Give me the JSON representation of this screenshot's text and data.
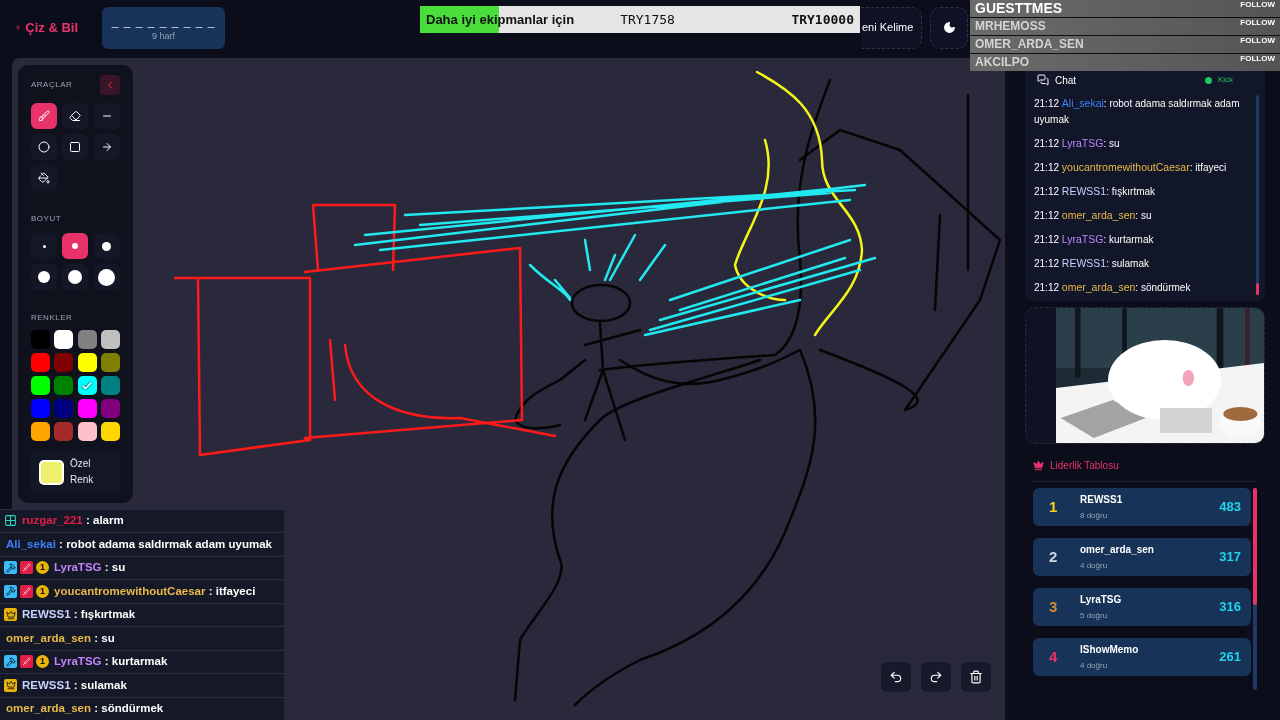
{
  "app": {
    "title": "Çiz & Bil"
  },
  "word_hint": {
    "blanks": "_ _ _ _ _ _ _ _ _",
    "letters": "9 harf"
  },
  "donation_goal": {
    "title": "Daha iyi ekipmanlar için",
    "current": "TRY1758",
    "target": "TRY10000",
    "level": 0.18
  },
  "header_buttons": [
    {
      "kind": "new-word",
      "label": "eni Kelime"
    },
    {
      "kind": "theme"
    }
  ],
  "follower_list": [
    {
      "name": "GUESTTMES",
      "action": "FOLLOW"
    },
    {
      "name": "MRHEMOSS",
      "action": "FOLLOW"
    },
    {
      "name": "OMER_ARDA_SEN",
      "action": "FOLLOW"
    },
    {
      "name": "AKCILPO",
      "action": "FOLLOW"
    }
  ],
  "tools": {
    "heading": "ARAÇLAR",
    "items": [
      {
        "kind": "brush",
        "selected": true
      },
      {
        "kind": "eraser",
        "selected": false
      },
      {
        "kind": "line",
        "selected": false
      },
      {
        "kind": "circle",
        "selected": false
      },
      {
        "kind": "rectangle",
        "selected": false
      },
      {
        "kind": "arrow",
        "selected": false
      },
      {
        "kind": "fill",
        "selected": false
      }
    ],
    "sizes_heading": "BOYUT",
    "sizes": [
      {
        "selected": false
      },
      {
        "selected": true
      },
      {
        "selected": false
      },
      {
        "selected": false
      },
      {
        "selected": false
      },
      {
        "selected": false
      }
    ],
    "colors_heading": "RENKLER",
    "colors": [
      {
        "color": "#000000",
        "selected": false
      },
      {
        "color": "#ffffff",
        "selected": false
      },
      {
        "color": "#808080",
        "selected": false
      },
      {
        "color": "#c0c0c0",
        "selected": false
      },
      {
        "color": "#ff0000",
        "selected": false
      },
      {
        "color": "#800000",
        "selected": false
      },
      {
        "color": "#ffff00",
        "selected": false
      },
      {
        "color": "#808000",
        "selected": false
      },
      {
        "color": "#00ff00",
        "selected": false
      },
      {
        "color": "#008000",
        "selected": false
      },
      {
        "color": "#00ffff",
        "selected": true
      },
      {
        "color": "#008080",
        "selected": false
      },
      {
        "color": "#0000ff",
        "selected": false
      },
      {
        "color": "#000080",
        "selected": false
      },
      {
        "color": "#ff00ff",
        "selected": false
      },
      {
        "color": "#800080",
        "selected": false
      },
      {
        "color": "#ffa500",
        "selected": false
      },
      {
        "color": "#a52a2a",
        "selected": false
      },
      {
        "color": "#ffc0cb",
        "selected": false
      },
      {
        "color": "#ffd700",
        "selected": false
      }
    ],
    "custom_color": {
      "label": "Özel Renk",
      "color": "#eef06a"
    }
  },
  "canvas_controls": [
    {
      "kind": "undo"
    },
    {
      "kind": "redo"
    },
    {
      "kind": "clear"
    }
  ],
  "chat": {
    "title": "Chat",
    "platform": "Kick",
    "separator": ":",
    "messages": [
      {
        "time": "21:12",
        "user": "Ali_sekai",
        "color": "#3b82f6",
        "text": "robot adama saldırmak adam uyumak"
      },
      {
        "time": "21:12",
        "user": "LyraTSG",
        "color": "#c084fc",
        "text": "su"
      },
      {
        "time": "21:12",
        "user": "youcantromewithoutCaesar",
        "color": "#e9b949",
        "text": "itfayeci"
      },
      {
        "time": "21:12",
        "user": "REWSS1",
        "color": "#c7d2fe",
        "text": "fışkırtmak"
      },
      {
        "time": "21:12",
        "user": "omer_arda_sen",
        "color": "#e9b949",
        "text": "su"
      },
      {
        "time": "21:12",
        "user": "LyraTSG",
        "color": "#c084fc",
        "text": "kurtarmak"
      },
      {
        "time": "21:12",
        "user": "REWSS1",
        "color": "#c7d2fe",
        "text": "sulamak"
      },
      {
        "time": "21:12",
        "user": "omer_arda_sen",
        "color": "#e9b949",
        "text": "söndürmek"
      }
    ]
  },
  "leaderboard": {
    "title": "Liderlik Tablosu",
    "rows": [
      {
        "rank": "1",
        "name": "REWSS1",
        "detail": "8 doğru",
        "score": "483",
        "color": "#facc15"
      },
      {
        "rank": "2",
        "name": "omer_arda_sen",
        "detail": "4 doğru",
        "score": "317",
        "color": "#cbd5e1"
      },
      {
        "rank": "3",
        "name": "LyraTSG",
        "detail": "5 doğru",
        "score": "316",
        "color": "#d08a3c"
      },
      {
        "rank": "4",
        "name": "IShowMemo",
        "detail": "4 doğru",
        "score": "261",
        "color": "#e8336a"
      }
    ]
  },
  "stream_chat": {
    "separator": ":",
    "messages": [
      {
        "badges": [
          {
            "kind": "pixel"
          }
        ],
        "user": "ruzgar_221",
        "color": "#e11d48",
        "text": "alarm"
      },
      {
        "user": "Ali_sekai",
        "color": "#3b82f6",
        "text": "robot adama saldırmak adam uyumak"
      },
      {
        "badges": [
          {
            "kind": "mod"
          },
          {
            "kind": "sub"
          },
          {
            "kind": "coin",
            "label": "1"
          }
        ],
        "user": "LyraTSG",
        "color": "#c084fc",
        "text": "su"
      },
      {
        "badges": [
          {
            "kind": "mod"
          },
          {
            "kind": "sub"
          },
          {
            "kind": "coin",
            "label": "1"
          }
        ],
        "user": "youcantromewithoutCaesar",
        "color": "#e9b949",
        "text": "itfayeci"
      },
      {
        "badges": [
          {
            "kind": "crown"
          }
        ],
        "user": "REWSS1",
        "color": "#c7d2fe",
        "text": "fışkırtmak"
      },
      {
        "user": "omer_arda_sen",
        "color": "#e9b949",
        "text": "su"
      },
      {
        "badges": [
          {
            "kind": "mod"
          },
          {
            "kind": "sub"
          },
          {
            "kind": "coin",
            "label": "1"
          }
        ],
        "user": "LyraTSG",
        "color": "#c084fc",
        "text": "kurtarmak"
      },
      {
        "badges": [
          {
            "kind": "crown"
          }
        ],
        "user": "REWSS1",
        "color": "#c7d2fe",
        "text": "sulamak"
      },
      {
        "user": "omer_arda_sen",
        "color": "#e9b949",
        "text": "söndürmek"
      }
    ]
  }
}
